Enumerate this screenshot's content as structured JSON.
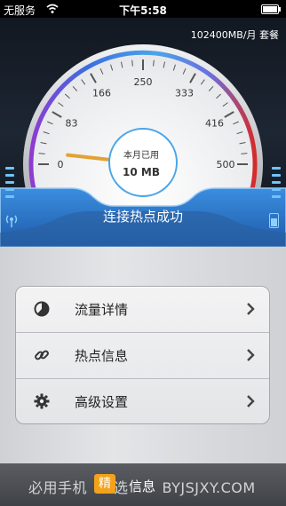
{
  "status_bar": {
    "carrier": "无服务",
    "time": "下午5:58"
  },
  "plan": {
    "text": "102400MB/月 套餐"
  },
  "gauge": {
    "ticks": [
      "0",
      "83",
      "166",
      "250",
      "333",
      "416",
      "500"
    ],
    "used_label": "本月已用",
    "used_value": "10 MB",
    "needle_value": 10
  },
  "connection": {
    "status": "连接热点成功"
  },
  "menu": {
    "items": [
      {
        "label": "流量详情",
        "icon": "pie-chart-icon"
      },
      {
        "label": "热点信息",
        "icon": "link-icon"
      },
      {
        "label": "高级设置",
        "icon": "gear-icon"
      }
    ]
  },
  "footer": {
    "watermark": "必用手机",
    "watermark_suffix": "选",
    "watermark_url": "BYJSJXY.COM",
    "badge": "精",
    "info": "信息"
  },
  "colors": {
    "accent_blue": "#3a8ad8",
    "gauge_red": "#d52b2b",
    "gauge_purple": "#8e3bd1",
    "needle": "#e3a233",
    "badge_orange": "#f4a21b"
  }
}
